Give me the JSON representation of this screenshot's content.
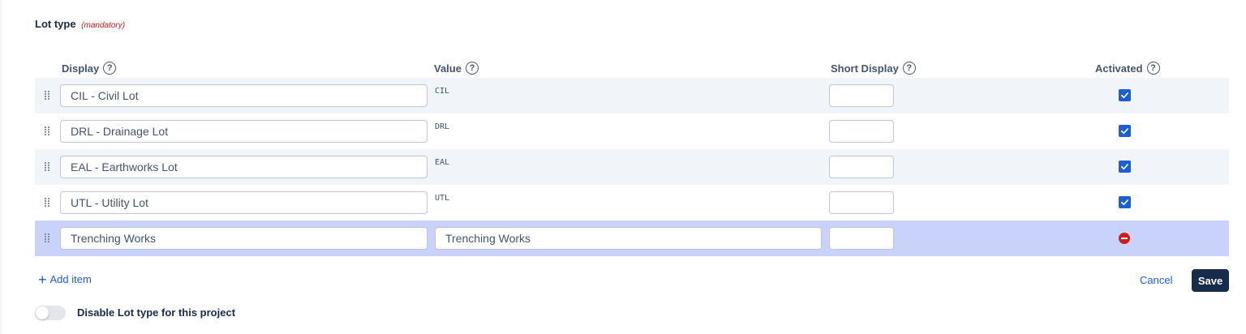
{
  "section": {
    "title": "Lot type",
    "mandatory": "(mandatory)"
  },
  "columns": {
    "display": "Display",
    "value": "Value",
    "short_display": "Short Display",
    "activated": "Activated"
  },
  "rows": [
    {
      "display": "CIL - Civil Lot",
      "value": "CIL",
      "short_display": "",
      "activated": true
    },
    {
      "display": "DRL - Drainage Lot",
      "value": "DRL",
      "short_display": "",
      "activated": true
    },
    {
      "display": "EAL - Earthworks Lot",
      "value": "EAL",
      "short_display": "",
      "activated": true
    },
    {
      "display": "UTL - Utility Lot",
      "value": "UTL",
      "short_display": "",
      "activated": true
    }
  ],
  "new_row": {
    "display": "Trenching Works",
    "value": "Trenching Works",
    "short_display": ""
  },
  "actions": {
    "add_item": "Add item",
    "cancel": "Cancel",
    "save": "Save"
  },
  "toggle": {
    "label": "Disable Lot type for this project",
    "on": false
  },
  "colors": {
    "accent": "#1d5ed8",
    "save_bg": "#172b4d",
    "mandatory": "#d11a1a",
    "new_row_bg": "#c8d2fa",
    "alt_row_bg": "#f1f4f9"
  },
  "icons": {
    "help": "question-circle-icon",
    "drag": "drag-handle-icon",
    "checked": "checkbox-checked-icon",
    "remove": "remove-circle-icon",
    "add": "plus-icon"
  }
}
